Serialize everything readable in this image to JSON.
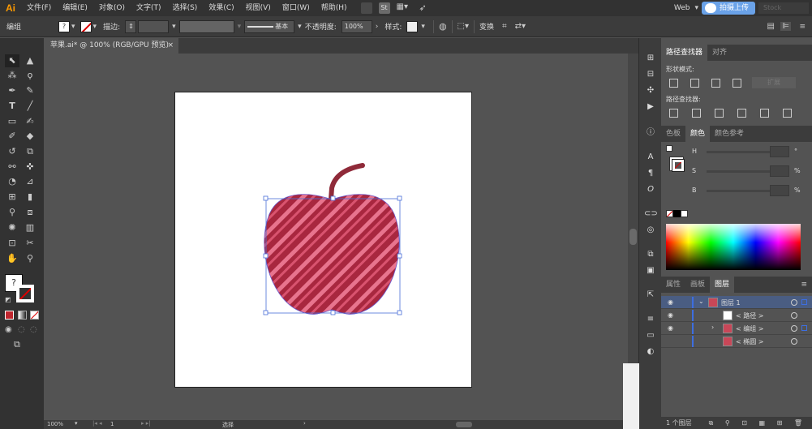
{
  "menubar": {
    "logo": "Ai",
    "items": [
      "文件(F)",
      "编辑(E)",
      "对象(O)",
      "文字(T)",
      "选择(S)",
      "效果(C)",
      "视图(V)",
      "窗口(W)",
      "帮助(H)"
    ],
    "bridge_label": "St",
    "workspace": "Web",
    "upload_label": "拍摄上传",
    "search_stock": "Stock"
  },
  "controlbar": {
    "object_type": "编组",
    "stroke_label": "描边:",
    "stroke_style": "基本",
    "opacity_label": "不透明度:",
    "opacity_value": "100%",
    "style_label": "样式:",
    "transform_label": "变换"
  },
  "document_tab": {
    "title": "苹果.ai* @ 100% (RGB/GPU 预览)",
    "close": "×"
  },
  "statusbar": {
    "zoom": "100%",
    "page": "1",
    "tool": "选择"
  },
  "pathfinder_panel": {
    "tabs": [
      "路径查找器",
      "对齐"
    ],
    "shape_modes_label": "形状模式:",
    "expand_label": "扩展",
    "pathfinders_label": "路径查找器:"
  },
  "color_panel": {
    "tabs": [
      "色板",
      "颜色",
      "颜色参考"
    ],
    "channels": [
      {
        "label": "H",
        "unit": "°"
      },
      {
        "label": "S",
        "unit": "%"
      },
      {
        "label": "B",
        "unit": "%"
      }
    ]
  },
  "layers_panel": {
    "tabs": [
      "属性",
      "画板",
      "图层"
    ],
    "rows": [
      {
        "name": "图层 1",
        "selected": true
      },
      {
        "name": "< 路径 >",
        "selected": false
      },
      {
        "name": "< 编组 >",
        "selected": false
      },
      {
        "name": "< 椭圆 >",
        "selected": false
      }
    ],
    "footer": "1 个图层"
  },
  "colors": {
    "apple_dark": "#a8273f",
    "apple_light": "#e8748e",
    "stem": "#8f2a39",
    "selection": "#4a6fd8",
    "accent": "#ff9a00"
  }
}
